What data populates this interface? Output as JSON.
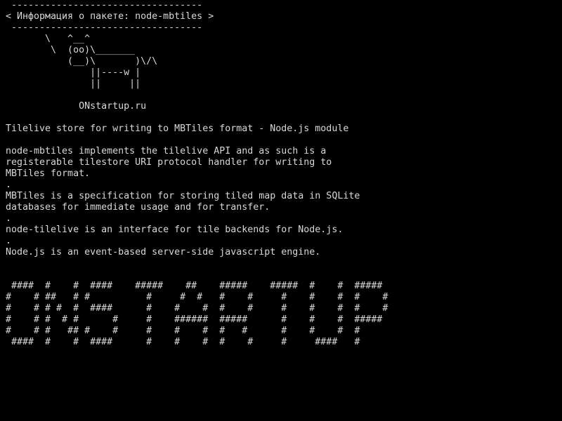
{
  "terminal": {
    "lines": [
      " ----------------------------------",
      "< Информация о пакете: node-mbtiles >",
      " ----------------------------------",
      "       \\   ^__^",
      "        \\  (oo)\\_______",
      "           (__)\\       )\\/\\",
      "               ||----w |",
      "               ||     ||",
      "",
      "             ONstartup.ru",
      "",
      "Tilelive store for writing to MBTiles format - Node.js module",
      "",
      "node-mbtiles implements the tilelive API and as such is a",
      "registerable tilestore URI protocol handler for writing to",
      "MBTiles format.",
      ".",
      "MBTiles is a specification for storing tiled map data in SQLite",
      "databases for immediate usage and for transfer.",
      ".",
      "node-tilelive is an interface for tile backends for Node.js.",
      ".",
      "Node.js is an event-based server-side javascript engine.",
      "",
      "",
      " ####  #    #  ####    #####    ##    #####    #####  #    #  #####",
      "#    # ##   # #          #     #  #   #    #     #    #    #  #    #",
      "#    # # #  #  ####      #    #    #  #    #     #    #    #  #    #",
      "#    # #  # #      #     #    ######  #####      #    #    #  #####",
      "#    # #   ## #    #     #    #    #  #   #      #    #    #  #",
      " ####  #    #  ####      #    #    #  #    #     #     ####   #"
    ]
  }
}
